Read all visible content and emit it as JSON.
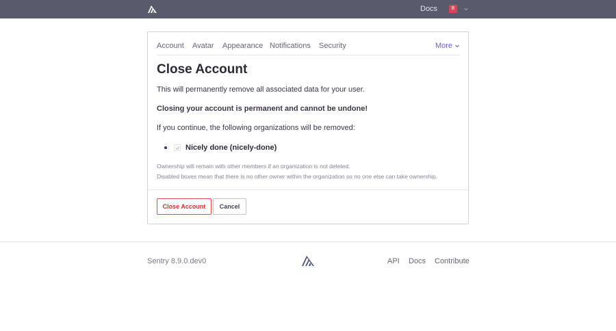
{
  "topbar": {
    "logo_icon": "sentry-logo-icon",
    "docs_label": "Docs",
    "avatar_initial": "B",
    "avatar_color": "#d0485b",
    "menu_icon": "chevron-down-icon"
  },
  "tabs": {
    "items": [
      "Account",
      "Avatar",
      "Appearance",
      "Notifications",
      "Security"
    ],
    "more_label": "More"
  },
  "content": {
    "title": "Close Account",
    "intro": "This will permanently remove all associated data for your user.",
    "warning": "Closing your account is permanent and cannot be undone!",
    "orgs_intro": "If you continue, the following organizations will be removed:",
    "organizations": [
      {
        "label": "Nicely done (nicely-done)",
        "checked": true,
        "disabled": true
      }
    ],
    "help_line_1": "Ownership will remain with other members if an organization is not deleted.",
    "help_line_2": "Disabled boxes mean that there is no other owner within the organization so no one else can take ownership."
  },
  "actions": {
    "close_label": "Close Account",
    "cancel_label": "Cancel"
  },
  "footer": {
    "version": "Sentry 8.9.0.dev0",
    "links": [
      "API",
      "Docs",
      "Contribute"
    ]
  },
  "colors": {
    "header_bg": "#575b6b",
    "accent": "#6c5fc7",
    "danger": "#c83232"
  }
}
